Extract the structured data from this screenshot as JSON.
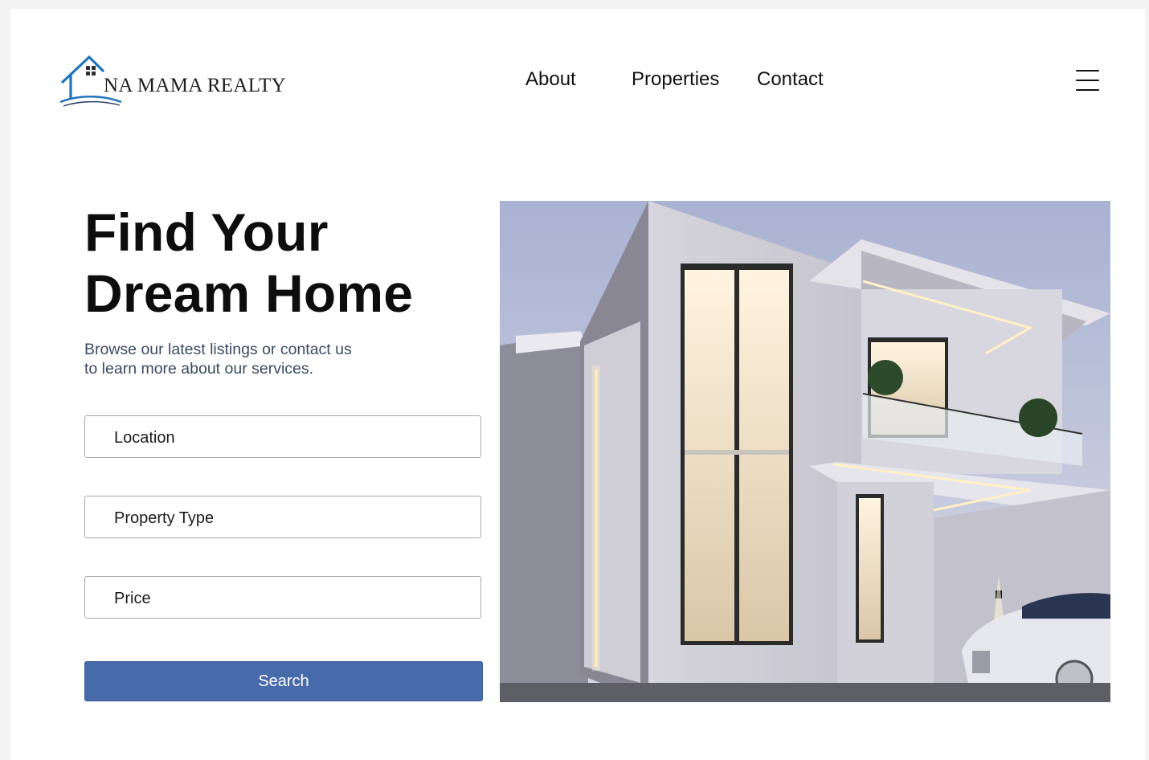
{
  "brand": {
    "name": "NA MAMA REALTY",
    "logo_icon": "house-logo-icon"
  },
  "nav": {
    "items": [
      {
        "label": "About"
      },
      {
        "label": "Properties"
      },
      {
        "label": "Contact"
      }
    ],
    "menu_icon": "hamburger-menu-icon"
  },
  "hero": {
    "title_line1": "Find Your",
    "title_line2": "Dream Home",
    "subtitle_line1": "Browse our latest listings or contact us",
    "subtitle_line2": "to learn more about our services."
  },
  "search_form": {
    "location_placeholder": "Location",
    "property_type_placeholder": "Property Type",
    "price_placeholder": "Price",
    "submit_label": "Search"
  },
  "colors": {
    "accent": "#466aaa",
    "logo_blue": "#1e73be",
    "subtitle": "#3b4a63"
  }
}
